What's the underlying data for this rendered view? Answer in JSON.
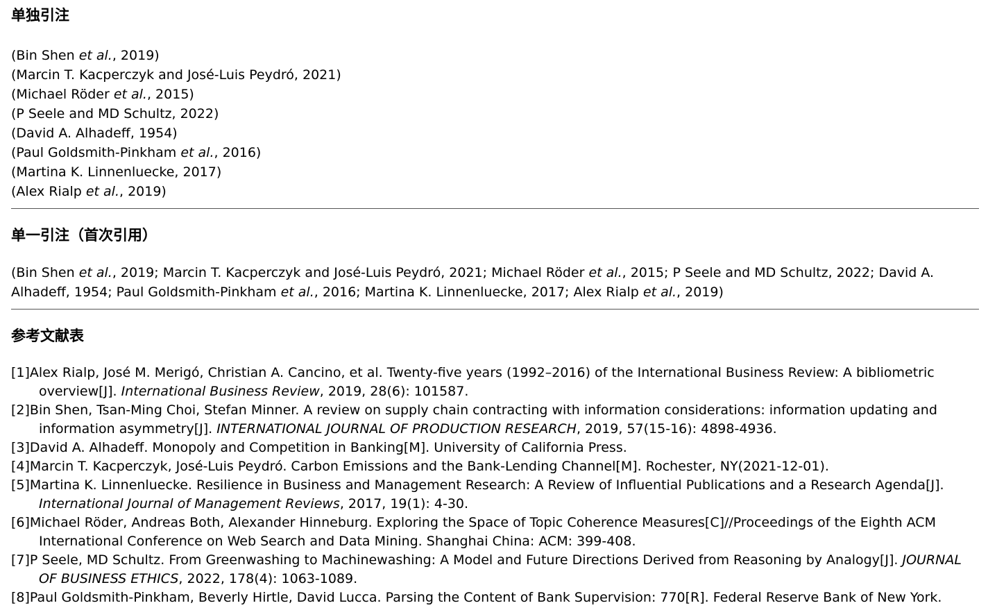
{
  "sections": {
    "single": {
      "title": "单独引注"
    },
    "combined": {
      "title": "单一引注（首次引用）"
    },
    "refs": {
      "title": "参考文献表"
    }
  },
  "single_citations": [
    {
      "author": "Bin Shen",
      "etal": "et al.",
      "year": ", 2019)"
    },
    {
      "author": "Marcin T. Kacperczyk and José-Luis Peydró",
      "etal": "",
      "year": ", 2021)"
    },
    {
      "author": "Michael Röder",
      "etal": "et al.",
      "year": ", 2015)"
    },
    {
      "author": "P Seele and MD Schultz",
      "etal": "",
      "year": ", 2022)"
    },
    {
      "author": "David A. Alhadeff",
      "etal": "",
      "year": ", 1954)"
    },
    {
      "author": "Paul Goldsmith-Pinkham",
      "etal": "et al.",
      "year": ", 2016)"
    },
    {
      "author": "Martina K. Linnenluecke",
      "etal": "",
      "year": ", 2017)"
    },
    {
      "author": "Alex Rialp",
      "etal": "et al.",
      "year": ", 2019)"
    }
  ],
  "combined": {
    "p1": "(Bin Shen ",
    "i1": "et al.",
    "p2": ", 2019; Marcin T. Kacperczyk and José-Luis Peydró, 2021; Michael Röder ",
    "i2": "et al.",
    "p3": ", 2015; P Seele and MD Schultz, 2022; David A. Alhadeff, 1954; Paul Goldsmith-Pinkham ",
    "i3": "et al.",
    "p4": ", 2016; Martina K. Linnenluecke, 2017; Alex Rialp ",
    "i4": "et al.",
    "p5": ", 2019)"
  },
  "references": [
    {
      "text": "[1]Alex Rialp, José M. Merigó, Christian A. Cancino, et al. Twenty-five years (1992–2016) of the International Business Review: A bibliometric overview[J]. ",
      "journal": "International Business Review",
      "tail": ", 2019, 28(6): 101587."
    },
    {
      "text": "[2]Bin Shen, Tsan-Ming Choi, Stefan Minner. A review on supply chain contracting with information considerations: information updating and information asymmetry[J]. ",
      "journal": "INTERNATIONAL JOURNAL OF PRODUCTION RESEARCH",
      "tail": ", 2019, 57(15-16): 4898-4936."
    },
    {
      "text": "[3]David A. Alhadeff. Monopoly and Competition in Banking[M]. University of California Press.",
      "journal": "",
      "tail": ""
    },
    {
      "text": "[4]Marcin T. Kacperczyk, José-Luis Peydró. Carbon Emissions and the Bank-Lending Channel[M]. Rochester, NY(2021-12-01).",
      "journal": "",
      "tail": ""
    },
    {
      "text": "[5]Martina K. Linnenluecke. Resilience in Business and Management Research: A Review of Influential Publications and a Research Agenda[J]. ",
      "journal": "International Journal of Management Reviews",
      "tail": ", 2017, 19(1): 4-30."
    },
    {
      "text": "[6]Michael Röder, Andreas Both, Alexander Hinneburg. Exploring the Space of Topic Coherence Measures[C]//Proceedings of the Eighth ACM International Conference on Web Search and Data Mining. Shanghai China: ACM: 399-408.",
      "journal": "",
      "tail": ""
    },
    {
      "text": "[7]P Seele, MD Schultz. From Greenwashing to Machinewashing: A Model and Future Directions Derived from Reasoning by Analogy[J]. ",
      "journal": "JOURNAL OF BUSINESS ETHICS",
      "tail": ", 2022, 178(4): 1063-1089."
    },
    {
      "text": "[8]Paul Goldsmith-Pinkham, Beverly Hirtle, David Lucca. Parsing the Content of Bank Supervision: 770[R]. Federal Reserve Bank of New York.",
      "journal": "",
      "tail": ""
    }
  ]
}
